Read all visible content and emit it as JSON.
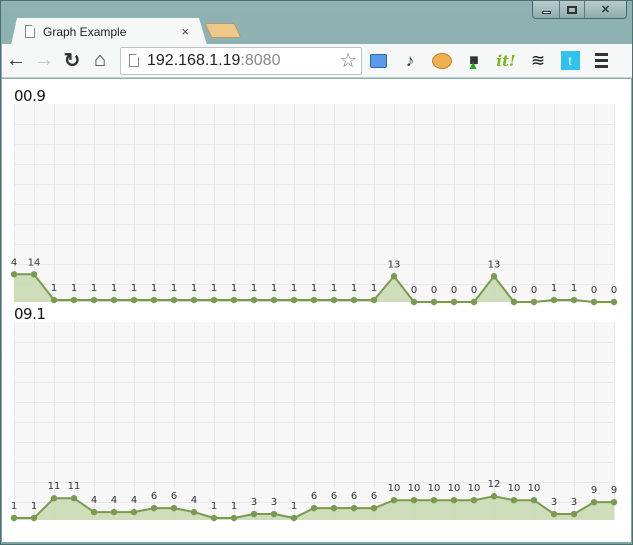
{
  "window": {
    "controls": [
      "minimize",
      "maximize",
      "close"
    ]
  },
  "tab": {
    "title": "Graph Example",
    "close_glyph": "×"
  },
  "toolbar": {
    "back_glyph": "←",
    "forward_glyph": "→",
    "reload_glyph": "↻",
    "home_glyph": "⌂",
    "url_host": "192.168.1.19",
    "url_port": ":8080",
    "bookmark_glyph": "☆",
    "extensions": [
      "speed-dial-icon",
      "lamp-icon",
      "pufferfish-icon",
      "evernote-icon",
      "scoopit-icon",
      "buffer-layers-icon",
      "twitter-icon"
    ],
    "scoopit_label": "it!",
    "layers_glyph": "≋",
    "twitter_glyph": "t"
  },
  "colors": {
    "line": "#7a9a50",
    "fill": "#c9dab3",
    "grid_bg": "#f7f7f7",
    "grid_line": "#e8e8e8"
  },
  "chart_data": [
    {
      "type": "area",
      "title": "00.9",
      "xlabel": "",
      "ylabel": "",
      "ylim": [
        0,
        100
      ],
      "grid": true,
      "x": [
        1,
        2,
        3,
        4,
        5,
        6,
        7,
        8,
        9,
        10,
        11,
        12,
        13,
        14,
        15,
        16,
        17,
        18,
        19,
        20,
        21,
        22,
        23,
        24,
        25,
        26,
        27,
        28,
        29,
        30,
        31
      ],
      "values": [
        14,
        14,
        1,
        1,
        1,
        1,
        1,
        1,
        1,
        1,
        1,
        1,
        1,
        1,
        1,
        1,
        1,
        1,
        1,
        13,
        0,
        0,
        0,
        0,
        13,
        0,
        0,
        1,
        1,
        0,
        0
      ],
      "labels": [
        "4",
        "14",
        "1",
        "1",
        "1",
        "1",
        "1",
        "1",
        "1",
        "1",
        "1",
        "1",
        "1",
        "1",
        "1",
        "1",
        "1",
        "1",
        "1",
        "13",
        "0",
        "0",
        "0",
        "0",
        "13",
        "0",
        "0",
        "1",
        "1",
        "0",
        "0"
      ]
    },
    {
      "type": "area",
      "title": "09.1",
      "xlabel": "",
      "ylabel": "",
      "ylim": [
        0,
        100
      ],
      "grid": true,
      "x": [
        1,
        2,
        3,
        4,
        5,
        6,
        7,
        8,
        9,
        10,
        11,
        12,
        13,
        14,
        15,
        16,
        17,
        18,
        19,
        20,
        21,
        22,
        23,
        24,
        25,
        26,
        27,
        28,
        29,
        30,
        31
      ],
      "values": [
        1,
        1,
        11,
        11,
        4,
        4,
        4,
        6,
        6,
        4,
        1,
        1,
        3,
        3,
        1,
        6,
        6,
        6,
        6,
        10,
        10,
        10,
        10,
        10,
        12,
        10,
        10,
        3,
        3,
        9,
        9
      ],
      "labels": [
        "1",
        "1",
        "11",
        "11",
        "4",
        "4",
        "4",
        "6",
        "6",
        "4",
        "1",
        "1",
        "3",
        "3",
        "1",
        "6",
        "6",
        "6",
        "6",
        "10",
        "10",
        "10",
        "10",
        "10",
        "12",
        "10",
        "10",
        "3",
        "3",
        "9",
        "9"
      ]
    }
  ]
}
